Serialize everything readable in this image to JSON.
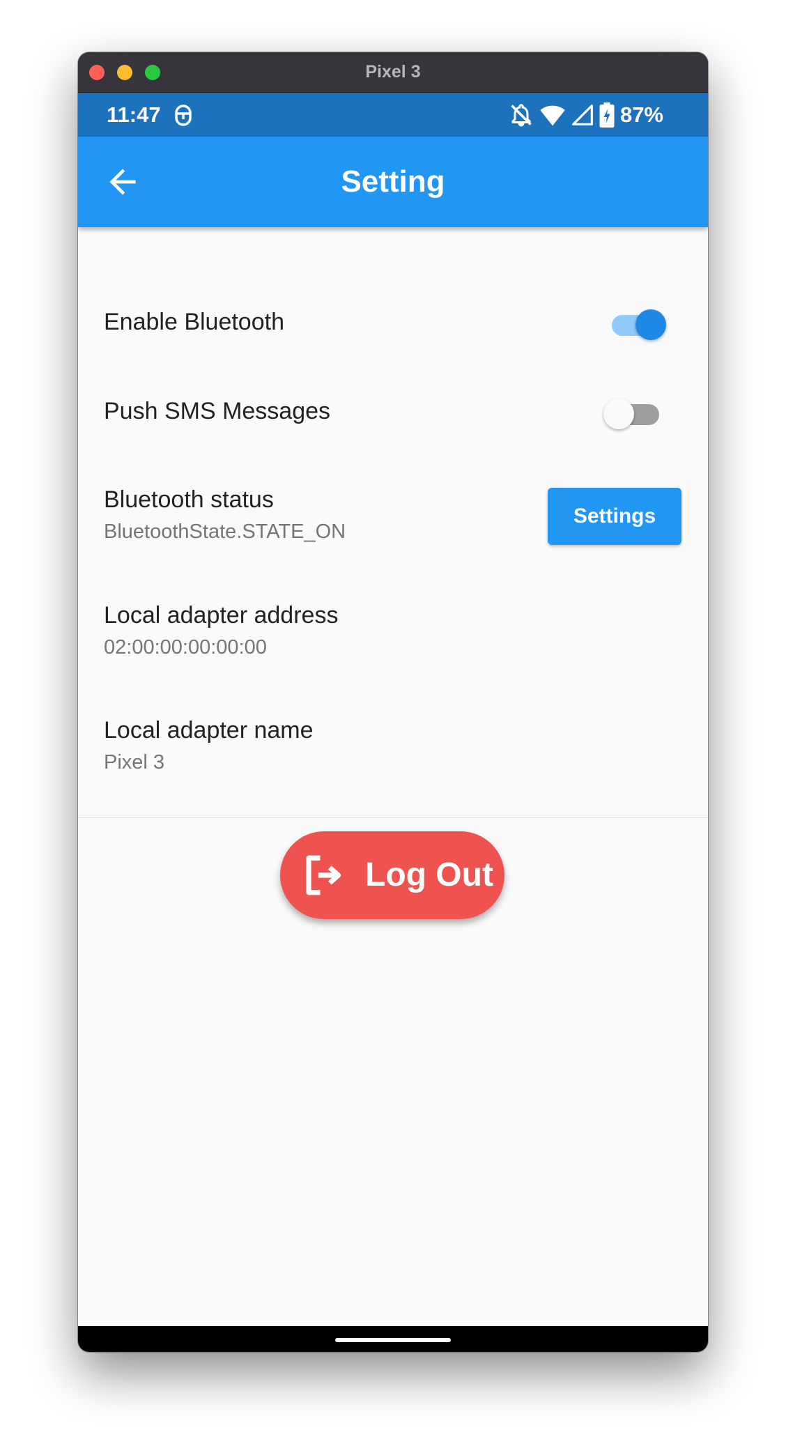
{
  "window": {
    "title": "Pixel 3"
  },
  "statusbar": {
    "time": "11:47",
    "battery": "87%",
    "icons": [
      "debug-icon",
      "notifications-off-icon",
      "wifi-icon",
      "cell-signal-icon",
      "battery-charging-icon"
    ]
  },
  "appbar": {
    "title": "Setting",
    "back_icon": "arrow-back-icon"
  },
  "settings": {
    "enable_bluetooth": {
      "label": "Enable Bluetooth",
      "on": true
    },
    "push_sms": {
      "label": "Push SMS Messages",
      "on": false
    },
    "bluetooth_status": {
      "label": "Bluetooth status",
      "value": "BluetoothState.STATE_ON",
      "button_label": "Settings"
    },
    "adapter_address": {
      "label": "Local adapter address",
      "value": "02:00:00:00:00:00"
    },
    "adapter_name": {
      "label": "Local adapter name",
      "value": "Pixel 3"
    }
  },
  "logout": {
    "label": "Log Out",
    "icon": "logout-icon"
  },
  "colors": {
    "statusbar": "#1c72bd",
    "appbar": "#2196f3",
    "switch_on_thumb": "#1e88e5",
    "switch_on_track": "#90caf9",
    "switch_off_thumb": "#fafafa",
    "switch_off_track": "#9e9e9e",
    "logout": "#ef5350"
  }
}
